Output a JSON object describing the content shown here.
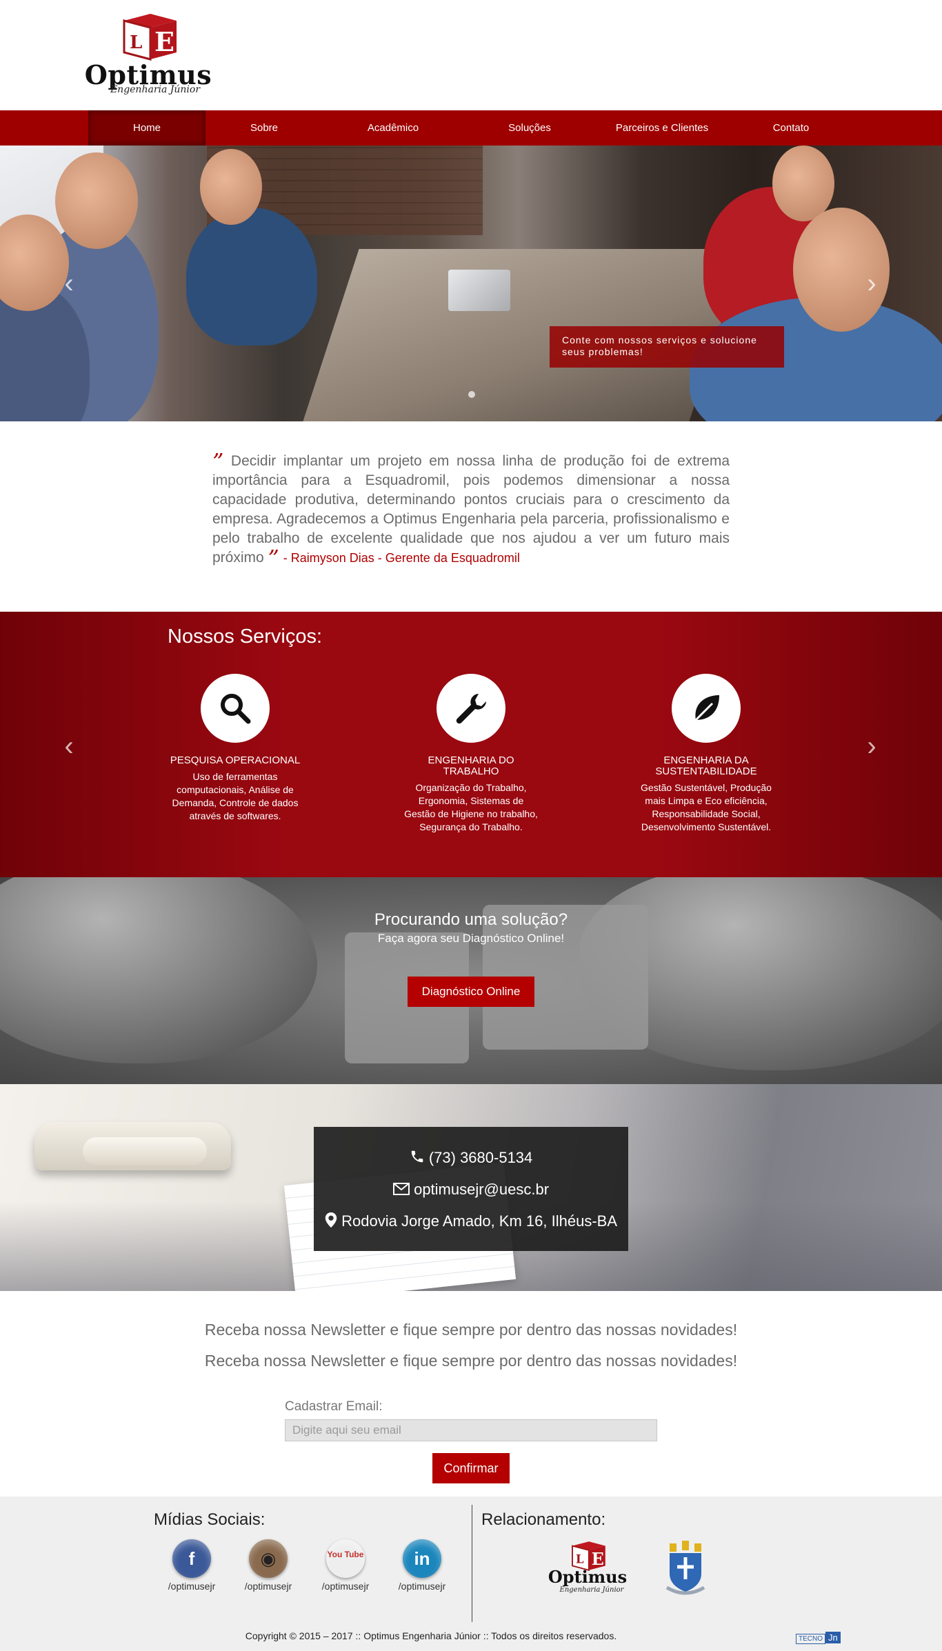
{
  "header": {
    "logo_word": "Optimus",
    "logo_sub": "Engenharia Júnior"
  },
  "nav": {
    "items": [
      {
        "label": "Home",
        "active": true
      },
      {
        "label": "Sobre"
      },
      {
        "label": "Acadêmico"
      },
      {
        "label": "Soluções"
      },
      {
        "label": "Parceiros e Clientes"
      },
      {
        "label": "Contato"
      }
    ]
  },
  "hero": {
    "caption": "Conte com nossos serviços e solucione seus problemas!"
  },
  "testimonial": {
    "open_quote": "”",
    "text": "Decidir implantar um projeto em nossa linha de produção foi de extrema importância para a Esquadromil, pois podemos dimensionar a nossa capacidade produtiva, determinando pontos cruciais para o crescimento da empresa. Agradecemos a Optimus Engenharia pela parceria, profissionalismo e pelo trabalho de excelente qualidade que nos ajudou a ver um futuro mais próximo",
    "close_quote": "”",
    "author": " - Raimyson Dias - Gerente da Esquadromil"
  },
  "services": {
    "title": "Nossos Serviços:",
    "items": [
      {
        "icon": "search-icon",
        "title": "PESQUISA OPERACIONAL",
        "text": "Uso de ferramentas computacionais, Análise de Demanda, Controle de dados através de softwares."
      },
      {
        "icon": "wrench-icon",
        "title": "ENGENHARIA DO TRABALHO",
        "text": "Organização do Trabalho, Ergonomia, Sistemas de Gestão de Higiene no trabalho, Segurança do Trabalho."
      },
      {
        "icon": "leaf-icon",
        "title": "ENGENHARIA DA SUSTENTABILIDADE",
        "text": "Gestão Sustentável, Produção mais Limpa e Eco eficiência, Responsabilidade Social, Desenvolvimento Sustentável."
      }
    ]
  },
  "cta": {
    "title": "Procurando uma solução?",
    "subtitle": "Faça agora seu Diagnóstico Online!",
    "button": "Diagnóstico Online"
  },
  "contact": {
    "phone": "(73) 3680-5134",
    "email": "optimusejr@uesc.br",
    "address": "Rodovia Jorge Amado, Km 16, Ilhéus-BA"
  },
  "newsletter": {
    "line1": "Receba nossa Newsletter e fique sempre por dentro das nossas novidades!",
    "line2": "Receba nossa Newsletter e fique sempre por dentro das nossas novidades!",
    "email_label": "Cadastrar Email:",
    "email_placeholder": "Digite aqui seu email",
    "confirm": "Confirmar"
  },
  "footer": {
    "social_title": "Mídias Sociais:",
    "relationship_title": "Relacionamento:",
    "social": [
      {
        "icon": "facebook-icon",
        "glyph": "f",
        "handle": "/optimusejr"
      },
      {
        "icon": "instagram-icon",
        "glyph": "◉",
        "handle": "/optimusejr"
      },
      {
        "icon": "youtube-icon",
        "glyph": "You Tube",
        "handle": "/optimusejr"
      },
      {
        "icon": "linkedin-icon",
        "glyph": "in",
        "handle": "/optimusejr"
      }
    ],
    "rel_logo_word": "Optimus",
    "rel_logo_sub": "Engenharia Júnior",
    "copyright": "Copyright © 2015 – 2017 :: Optimus Engenharia Júnior :: Todos os direitos reservados.",
    "tecno_word": "TECNO",
    "tecno_badge": "Jn"
  },
  "colors": {
    "brand_red": "#9e0000",
    "button_red": "#b40000"
  }
}
